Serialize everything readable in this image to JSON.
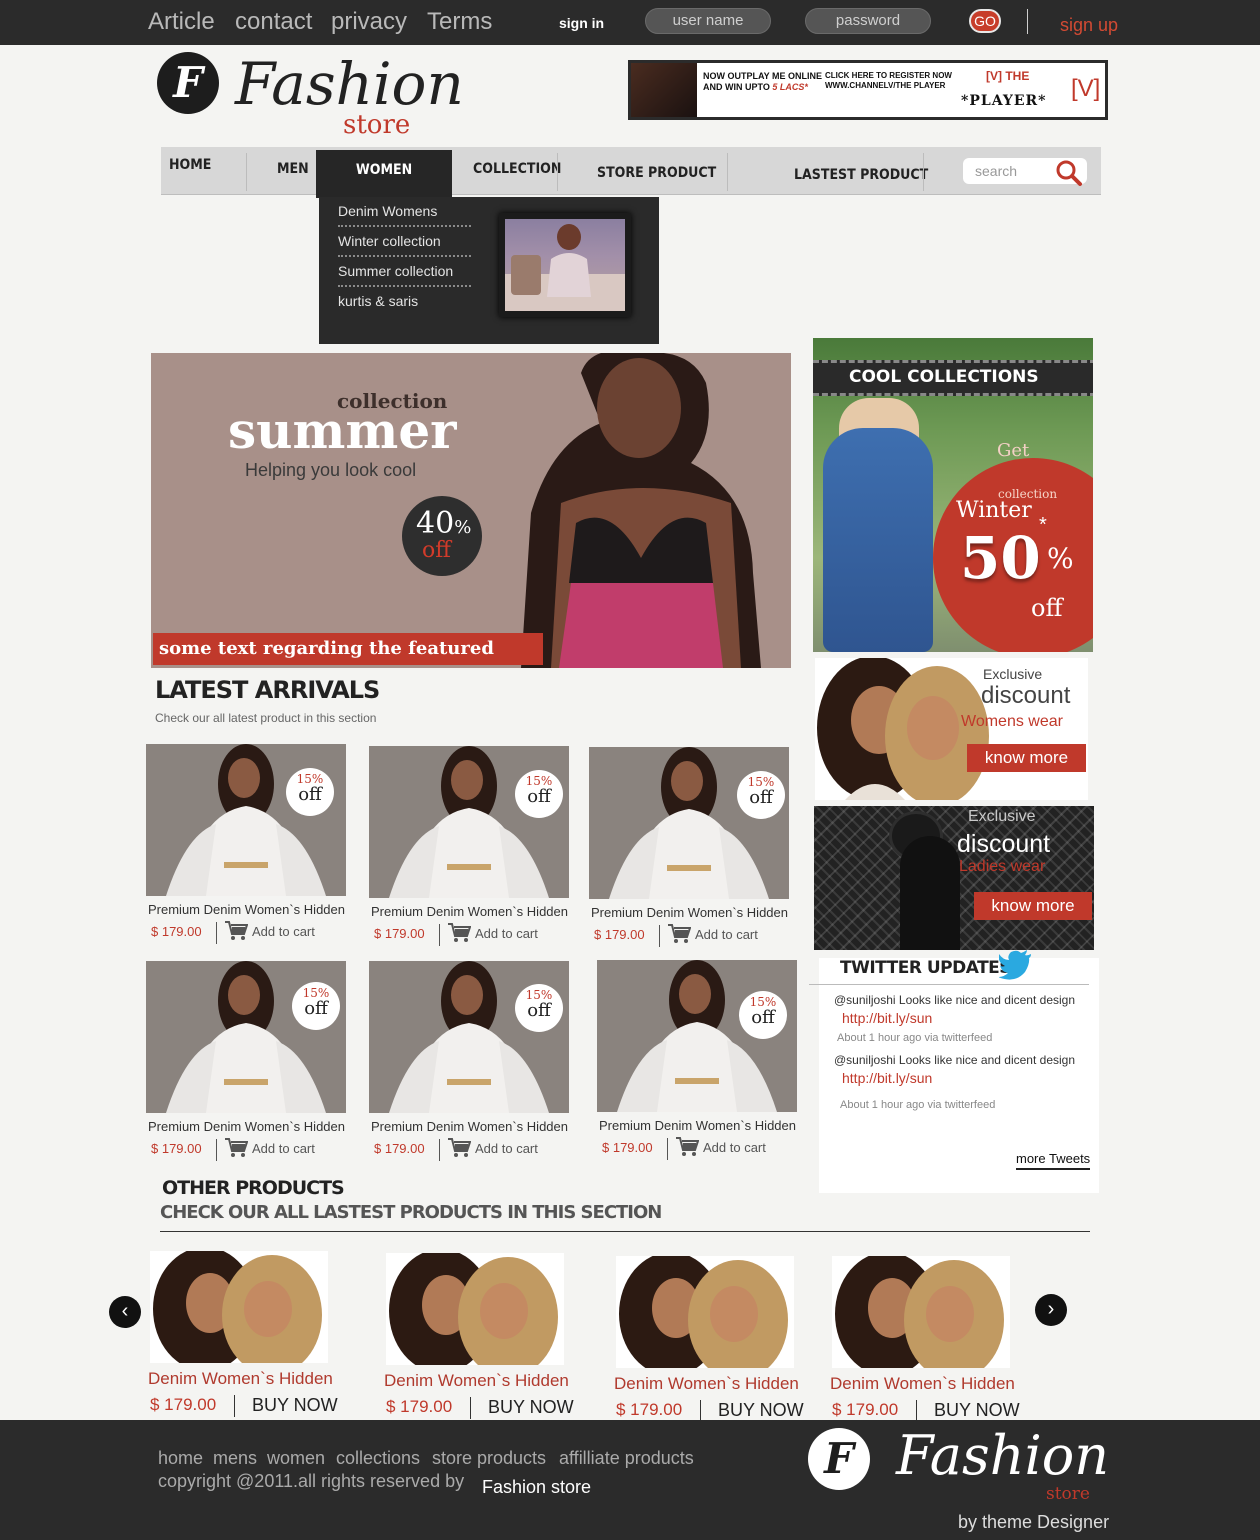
{
  "topbar": {
    "links": [
      "Article",
      "contact",
      "privacy",
      "Terms"
    ],
    "signin_label": "sign in",
    "username_placeholder": "user name",
    "password_placeholder": "password",
    "go_label": "GO",
    "signup_label": "sign up"
  },
  "logo": {
    "letter": "F",
    "word": "Fashion",
    "sub": "store"
  },
  "ad": {
    "line1": "NOW OUTPLAY ME ONLINE AND WIN UPTO",
    "line1_highlight": "5 LACS*",
    "line2": "CLICK HERE TO REGISTER NOW WWW.CHANNELV/THE PLAYER",
    "brand": "[V] THE",
    "player": "*PLAYER*",
    "logo": "[V]"
  },
  "nav": {
    "items": [
      "HOME",
      "MEN",
      "WOMEN",
      "COLLECTION",
      "STORE PRODUCT",
      "LASTEST PRODUCT"
    ],
    "search_placeholder": "search",
    "search_icon": "search-icon"
  },
  "dropdown": {
    "items": [
      "Denim Womens",
      "Winter collection",
      "Summer collection",
      "kurtis & saris"
    ]
  },
  "hero": {
    "collection": "collection",
    "title": "summer",
    "tagline": "Helping you look cool",
    "badge_pct": "40",
    "badge_pct_sign": "%",
    "badge_off": "off",
    "caption": "some text regarding the featured product"
  },
  "cool": {
    "title": "COOL COLLECTIONS",
    "get": "Get",
    "collection": "collection",
    "winter": "Winter",
    "value": "50",
    "star": "*",
    "pct": "%",
    "off": "off"
  },
  "discount1": {
    "exclusive": "Exclusive",
    "discount": "discount",
    "wear": "Womens wear",
    "button": "know more"
  },
  "discount2": {
    "exclusive": "Exclusive",
    "discount": "discount",
    "wear": "Ladies wear",
    "button": "know more"
  },
  "twitter": {
    "title": "TWITTER UPDATES",
    "tweets": [
      {
        "handle": "@suniljoshi",
        "text": "Looks like nice and dicent design",
        "link": "http://bit.ly/sun",
        "meta": "About 1 hour ago via twitterfeed"
      },
      {
        "handle": "@suniljoshi",
        "text": "Looks like nice and dicent design",
        "link": "http://bit.ly/sun",
        "meta": "About 1 hour ago via twitterfeed"
      }
    ],
    "more": "more Tweets"
  },
  "latest": {
    "title": "LATEST ARRIVALS",
    "subtitle": "Check our all latest product in this section",
    "products": [
      {
        "name": "Premium Denim Women`s Hidden",
        "price": "$ 179.00",
        "cart": "Add to cart",
        "badge_pct": "15%",
        "badge_off": "off"
      },
      {
        "name": "Premium Denim Women`s Hidden",
        "price": "$ 179.00",
        "cart": "Add to cart",
        "badge_pct": "15%",
        "badge_off": "off"
      },
      {
        "name": "Premium Denim Women`s Hidden",
        "price": "$ 179.00",
        "cart": "Add to cart",
        "badge_pct": "15%",
        "badge_off": "off"
      },
      {
        "name": "Premium Denim Women`s Hidden",
        "price": "$ 179.00",
        "cart": "Add to cart",
        "badge_pct": "15%",
        "badge_off": "off"
      },
      {
        "name": "Premium Denim Women`s Hidden",
        "price": "$ 179.00",
        "cart": "Add to cart",
        "badge_pct": "15%",
        "badge_off": "off"
      },
      {
        "name": "Premium Denim Women`s Hidden",
        "price": "$ 179.00",
        "cart": "Add to cart",
        "badge_pct": "15%",
        "badge_off": "off"
      }
    ]
  },
  "other": {
    "title": "OTHER PRODUCTS",
    "subtitle": "CHECK OUR ALL LASTEST PRODUCTS IN THIS SECTION",
    "products": [
      {
        "name": "Denim Women`s Hidden",
        "price": "$ 179.00",
        "buy": "BUY NOW"
      },
      {
        "name": "Denim Women`s Hidden",
        "price": "$ 179.00",
        "buy": "BUY NOW"
      },
      {
        "name": "Denim Women`s Hidden",
        "price": "$ 179.00",
        "buy": "BUY NOW"
      },
      {
        "name": "Denim Women`s Hidden",
        "price": "$ 179.00",
        "buy": "BUY NOW"
      }
    ],
    "prev": "‹",
    "next": "›"
  },
  "footer": {
    "links": [
      "home",
      "mens",
      "women",
      "collections",
      "store products",
      "affilliate products"
    ],
    "copyright": "copyright @2011.all rights reserved by",
    "store": "Fashion store",
    "by": "by theme Designer",
    "logo_letter": "F",
    "logo_word": "Fashion",
    "logo_sub": "store"
  },
  "colors": {
    "accent": "#c0392b",
    "dark": "#2b2b2b",
    "nav": "#d7d7d7"
  }
}
